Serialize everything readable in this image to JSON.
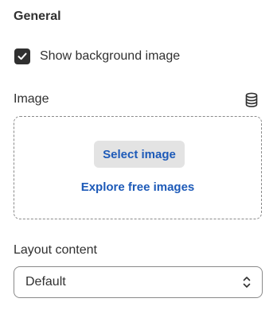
{
  "section": {
    "title": "General"
  },
  "background_toggle": {
    "label": "Show background image",
    "checked": true
  },
  "image": {
    "label": "Image",
    "select_button": "Select image",
    "explore_link": "Explore free images"
  },
  "layout": {
    "label": "Layout content",
    "value": "Default"
  },
  "colors": {
    "text": "#303030",
    "link": "#1d5ab8",
    "button_bg": "#e3e3e3",
    "border": "#8a8a8a"
  },
  "icons": {
    "checkbox": "checkmark-icon",
    "source": "database-icon",
    "select": "chevron-up-down-icon"
  }
}
